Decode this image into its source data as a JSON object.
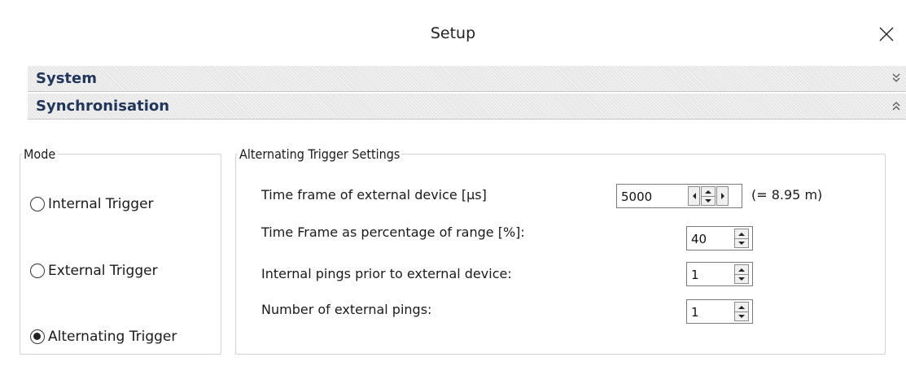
{
  "window": {
    "title": "Setup",
    "close_icon": "close-icon"
  },
  "sections": {
    "system": {
      "label": "System",
      "expanded": false
    },
    "synchronisation": {
      "label": "Synchronisation",
      "expanded": true
    }
  },
  "mode": {
    "legend": "Mode",
    "options": [
      {
        "label": "Internal Trigger",
        "checked": false
      },
      {
        "label": "External Trigger",
        "checked": false
      },
      {
        "label": "Alternating Trigger",
        "checked": true
      }
    ]
  },
  "alternating": {
    "legend": "Alternating Trigger Settings",
    "time_frame": {
      "label": "Time frame of external device [µs]",
      "value": "5000",
      "equivalent": "(= 8.95 m)"
    },
    "percentage": {
      "label": "Time Frame as percentage of range [%]:",
      "value": "40"
    },
    "internal_pings": {
      "label": "Internal pings prior to external device:",
      "value": "1"
    },
    "external_pings": {
      "label": "Number of external pings:",
      "value": "1"
    }
  },
  "colors": {
    "section_text": "#22365c",
    "section_bg": "#e7e7e7",
    "group_border": "#d2d2d2"
  }
}
